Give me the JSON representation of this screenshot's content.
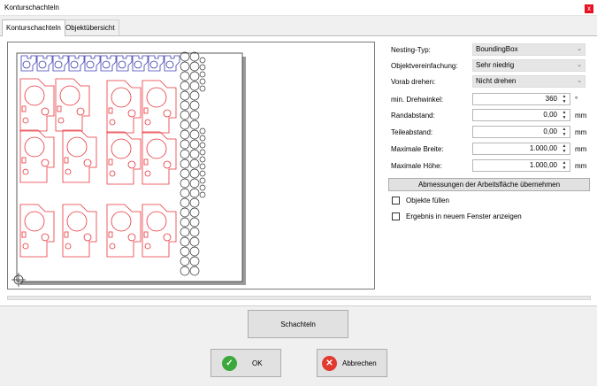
{
  "window": {
    "title": "Konturschachteln",
    "close_glyph": "x"
  },
  "tabs": [
    {
      "label": "Konturschachteln",
      "active": true
    },
    {
      "label": "Objektübersicht",
      "active": false
    }
  ],
  "settings": {
    "nesting_type": {
      "label": "Nesting-Typ:",
      "value": "BoundingBox"
    },
    "simplification": {
      "label": "Objektvereinfachung:",
      "value": "Sehr niedrig"
    },
    "prerotate": {
      "label": "Vorab drehen:",
      "value": "Nicht drehen"
    },
    "min_rotation": {
      "label": "min. Drehwinkel:",
      "value": "360",
      "unit": "°"
    },
    "border_distance": {
      "label": "Randabstand:",
      "value": "0,00",
      "unit": "mm"
    },
    "part_distance": {
      "label": "Teileabstand:",
      "value": "0,00",
      "unit": "mm"
    },
    "max_width": {
      "label": "Maximale Breite:",
      "value": "1.000,00",
      "unit": "mm"
    },
    "max_height": {
      "label": "Maximale Höhe:",
      "value": "1.000,00",
      "unit": "mm"
    }
  },
  "adopt_button": {
    "label": "Abmessungen der Arbeitsfläche übernehmen"
  },
  "checkboxes": [
    {
      "label": "Objekte füllen",
      "checked": false
    },
    {
      "label": "Ergebnis in neuem Fenster anzeigen",
      "checked": false
    }
  ],
  "actions": {
    "nest_label": "Schachteln",
    "ok_label": "OK",
    "cancel_label": "Abbrechen"
  },
  "colors": {
    "part_outline": "#e8343a",
    "top_row_outline": "#3c3cb4",
    "ok_icon": "#3aa83a",
    "cancel_icon": "#e23a2e"
  },
  "icons": {
    "ok": "check-icon",
    "cancel": "cross-icon",
    "origin": "crosshair-icon"
  }
}
